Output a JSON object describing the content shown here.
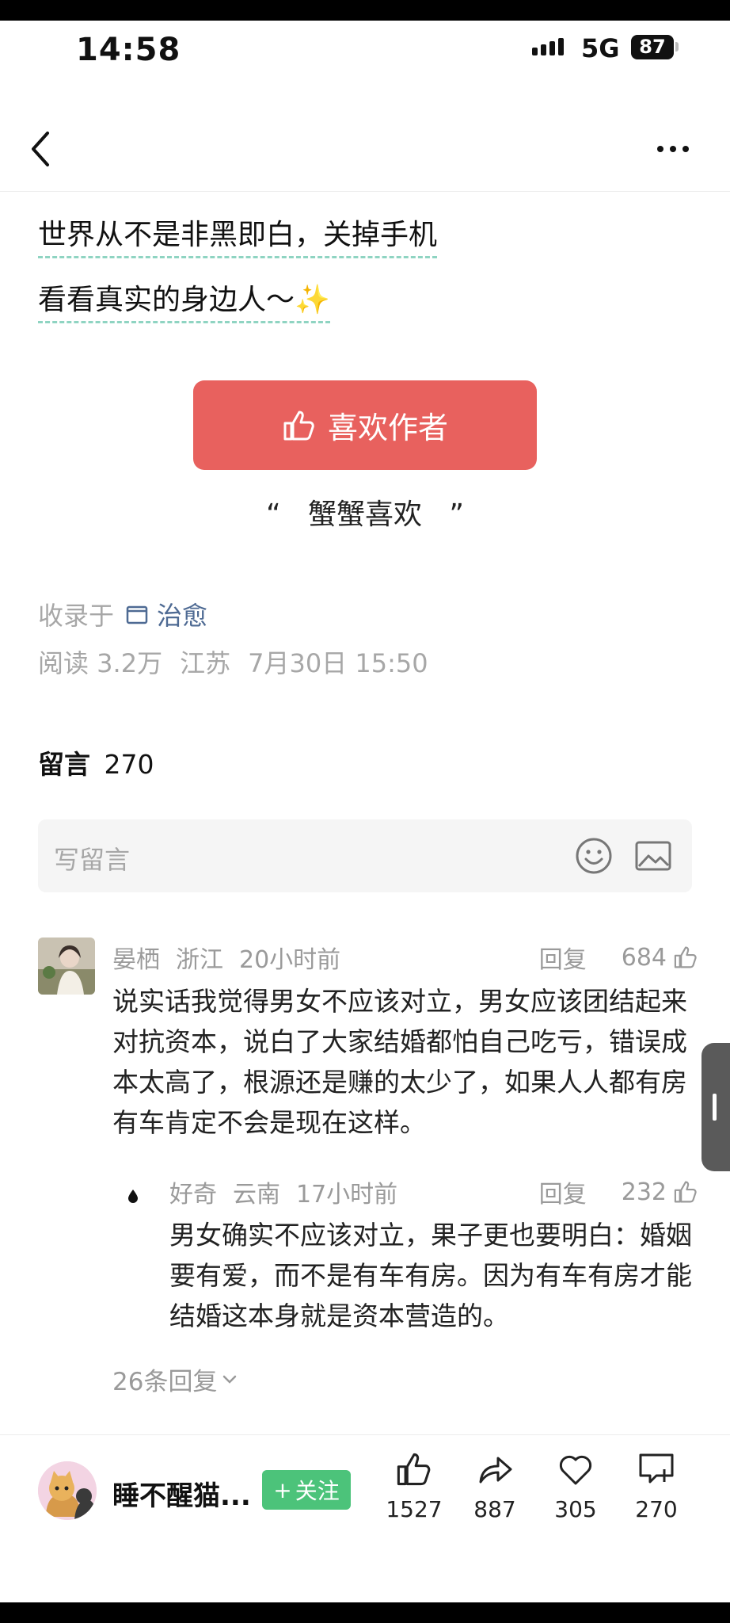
{
  "status_bar": {
    "time": "14:58",
    "network": "5G",
    "battery": "87"
  },
  "nav": {
    "back_icon": "chevron-left-icon",
    "more_icon": "more-horizontal-icon"
  },
  "article": {
    "line1": "世界从不是非黑即白，关掉手机",
    "line2": "看看真实的身边人～",
    "line2_emoji": "✨"
  },
  "like_author": {
    "label": "喜欢作者",
    "icon": "thumbs-up-icon"
  },
  "quote": {
    "open": "“",
    "text": "蟹蟹喜欢",
    "close": "”"
  },
  "meta": {
    "collected_label": "收录于",
    "collection_icon": "folder-icon",
    "collection": "治愈",
    "reads": "阅读 3.2万",
    "location": "江苏",
    "date": "7月30日 15:50"
  },
  "comments": {
    "title": "留言",
    "count": "270",
    "write_placeholder": "写留言",
    "emoji_icon": "emoji-icon",
    "image_icon": "image-icon"
  },
  "comment": {
    "author": "晏栖",
    "location": "浙江",
    "time": "20小时前",
    "reply_label": "回复",
    "likes": "684",
    "body": "说实话我觉得男女不应该对立，男女应该团结起来对抗资本，说白了大家结婚都怕自己吃亏，错误成本太高了，根源还是赚的太少了，如果人人都有房有车肯定不会是现在这样。",
    "reply": {
      "author": "好奇",
      "location": "云南",
      "time": "17小时前",
      "reply_label": "回复",
      "likes": "232",
      "body": "男女确实不应该对立，果子更也要明白：婚姻要有爱，而不是有车有房。因为有车有房才能结婚这本身就是资本营造的。"
    },
    "more_replies": "26条回复"
  },
  "bottom_bar": {
    "author_name": "睡不醒猫...",
    "follow_label": "关注",
    "follow_plus": "+",
    "like_count": "1527",
    "share_count": "887",
    "favorite_count": "305",
    "comment_count": "270"
  },
  "colors": {
    "accent_red": "#e8615e",
    "follow_green": "#4cc37a",
    "link_blue": "#4e6a93",
    "underline_teal": "#8fd4c2"
  }
}
